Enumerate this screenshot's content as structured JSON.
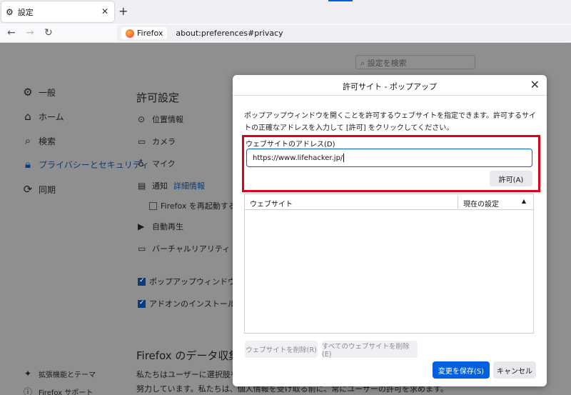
{
  "browser": {
    "tab_title": "設定",
    "url_badge": "Firefox",
    "url": "about:preferences#privacy"
  },
  "prefs": {
    "search_placeholder": "設定を検索",
    "sidebar": [
      {
        "label": "一般"
      },
      {
        "label": "ホーム"
      },
      {
        "label": "検索"
      },
      {
        "label": "プライバシーとセキュリティ"
      },
      {
        "label": "同期"
      }
    ],
    "sidebar_bottom": [
      {
        "label": "拡張機能とテーマ"
      },
      {
        "label": "Firefox サポート"
      }
    ],
    "permissions_heading": "許可設定",
    "permissions": {
      "location": "位置情報",
      "camera": "カメラ",
      "microphone": "マイク",
      "notifications": "通知",
      "notifications_link": "詳細情報",
      "restart_checkbox": "Firefox を再起動するま",
      "autoplay": "自動再生",
      "vr": "バーチャルリアリティ",
      "block_popups": "ポップアップウィンドウをブロッ",
      "addon_warn": "アドオンのインストールを求めら"
    },
    "data_heading": "Firefox のデータ収集と",
    "data_para1": "私たちはユーザーに選択肢を提供",
    "data_para2": "努力しています。私たちは、個人情報を受け取る前に、常にユーザーの許可を求めます。"
  },
  "dialog": {
    "title": "許可サイト - ポップアップ",
    "description": "ポップアップウィンドウを開くことを許可するウェブサイトを指定できます。許可するサイトの正確なアドレスを入力して [許可] をクリックしてください。",
    "address_label": "ウェブサイトのアドレス(D)",
    "address_value": "https://www.lifehacker.jp/",
    "allow_button": "許可(A)",
    "col_site": "ウェブサイト",
    "col_status": "現在の設定",
    "remove_button": "ウェブサイトを削除(R)",
    "remove_all_button": "すべてのウェブサイトを削除(E)",
    "save_button": "変更を保存(S)",
    "cancel_button": "キャンセル"
  }
}
